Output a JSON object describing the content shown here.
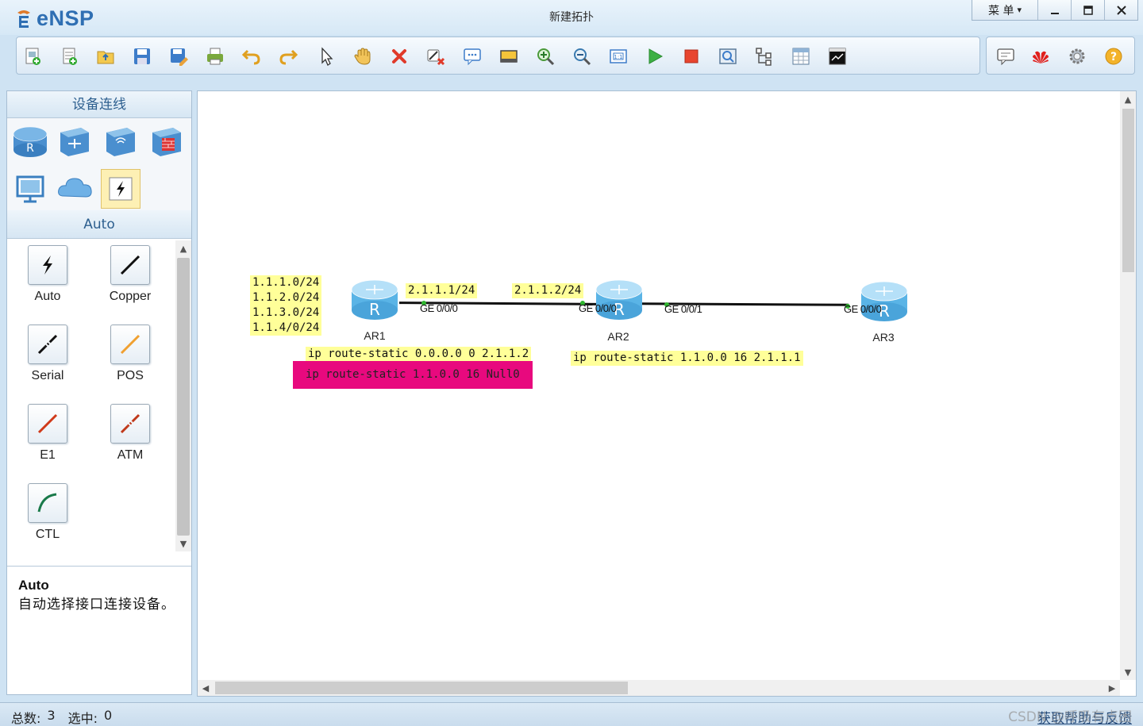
{
  "app": {
    "logo_text": "eNSP",
    "window_title": "新建拓扑",
    "menu_label": "菜 单",
    "menu_arrow": "▾"
  },
  "toolbar": {
    "items": [
      "new-topology",
      "new-from-template",
      "open",
      "save",
      "save-as",
      "print",
      "undo",
      "redo",
      "select",
      "pan",
      "delete",
      "delete-link",
      "text-note",
      "palette",
      "zoom-in",
      "zoom-out",
      "fit",
      "start-devices",
      "stop-devices",
      "capture",
      "topology",
      "grid",
      "console"
    ],
    "right_items": [
      "forum",
      "huawei",
      "settings",
      "help"
    ]
  },
  "left_panel": {
    "header": "设备连线",
    "devices": [
      "router",
      "switch",
      "wireless",
      "firewall",
      "pc",
      "cloud",
      "connection"
    ],
    "selected_category": "Auto",
    "cables": [
      {
        "label": "Auto",
        "color": "#111111"
      },
      {
        "label": "Copper",
        "color": "#111111"
      },
      {
        "label": "Serial",
        "color": "#111111"
      },
      {
        "label": "POS",
        "color": "#f0a030"
      },
      {
        "label": "E1",
        "color": "#d03a1a"
      },
      {
        "label": "ATM",
        "color": "#c0391a"
      },
      {
        "label": "CTL",
        "color": "#1a7a4a"
      }
    ],
    "desc_title": "Auto",
    "desc_text": "自动选择接口连接设备。"
  },
  "canvas": {
    "notes": {
      "ar1_networks": "1.1.1.0/24\n1.1.2.0/24\n1.1.3.0/24\n1.1.4/0/24",
      "ar1_ip": "2.1.1.1/24",
      "ar2_ip": "2.1.1.2/24",
      "ar1_default_route": "ip route-static 0.0.0.0 0 2.1.1.2",
      "ar1_null_route": "ip route-static 1.1.0.0 16 Null0",
      "ar2_route": "ip route-static 1.1.0.0 16 2.1.1.1"
    },
    "routers": [
      {
        "name": "AR1"
      },
      {
        "name": "AR2"
      },
      {
        "name": "AR3"
      }
    ],
    "ports": {
      "ar1_ge000": "GE 0/0/0",
      "ar2_ge000": "GE 0/0/0",
      "ar2_ge001": "GE 0/0/1",
      "ar3_ge000": "GE 0/0/0"
    }
  },
  "status": {
    "total_label": "总数:",
    "total_value": "3",
    "selected_label": "选中:",
    "selected_value": "0",
    "help_link": "获取帮助与反馈",
    "watermark": "CSDN @呼吸有点困"
  },
  "colors": {
    "note_yellow": "#ffff99",
    "note_magenta": "#e8097e",
    "link_dot": "#2fb52f",
    "router_blue": "#5ab4e6"
  }
}
